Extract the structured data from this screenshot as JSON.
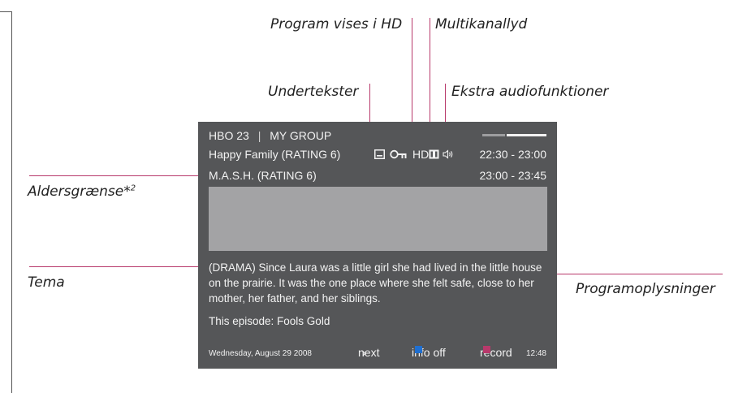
{
  "callouts": {
    "hd": "Program vises i HD",
    "multichannel": "Multikanallyd",
    "subtitles": "Undertekster",
    "extra_audio": "Ekstra audiofunktioner",
    "age_limit": "Aldersgrænse*",
    "age_limit_sup": "2",
    "theme": "Tema",
    "program_info": "Programoplysninger"
  },
  "osd": {
    "channel": "HBO 23",
    "separator": "|",
    "group": "MY GROUP",
    "current_program": "Happy Family (RATING 6)",
    "current_time": "22:30 - 23:00",
    "next_program": "M.A.S.H. (RATING 6)",
    "next_time": "23:00 - 23:45",
    "hd_label": "HD",
    "description": "(DRAMA) Since Laura was a little girl she had lived in the little house on the prairie. It was the one place where she felt safe, close to her mother, her father, and her siblings.",
    "episode": "This episode: Fools Gold",
    "date": "Wednesday, August 29 2008",
    "next_label": "next",
    "next_arrow": "›",
    "info_label": "info off",
    "record_label": "record",
    "clock": "12:48"
  },
  "colors": {
    "osd_background": "#555658",
    "leader_line": "#b8396b",
    "info_button": "#1f6fd1",
    "record_button": "#b8396b"
  }
}
